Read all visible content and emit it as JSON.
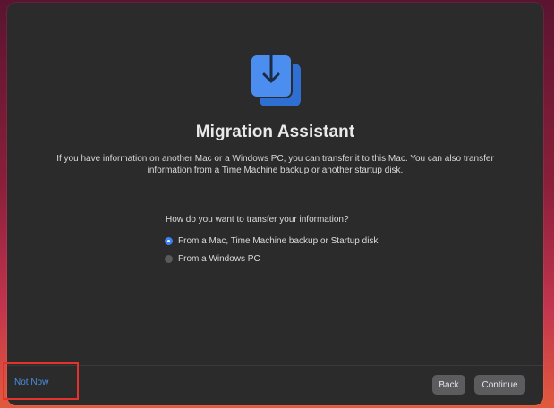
{
  "window": {
    "title": "Migration Assistant",
    "description": "If you have information on another Mac or a Windows PC, you can transfer it to this Mac. You can also transfer information from a Time Machine backup or another startup disk.",
    "question": "How do you want to transfer your information?",
    "options": [
      {
        "label": "From a Mac, Time Machine backup or Startup disk",
        "selected": true
      },
      {
        "label": "From a Windows PC",
        "selected": false
      }
    ]
  },
  "footer": {
    "not_now_label": "Not Now",
    "back_label": "Back",
    "continue_label": "Continue"
  },
  "icons": {
    "app_icon": "migration-assistant-icon"
  },
  "colors": {
    "window_bg": "#2b2b2c",
    "accent": "#3b82f6",
    "link": "#4a8fe0",
    "highlight": "#e5322d"
  }
}
